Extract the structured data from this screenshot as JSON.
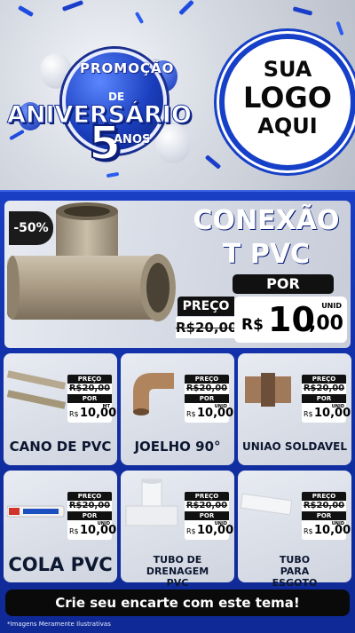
{
  "header": {
    "badge": {
      "promo": "PROMOÇÃO",
      "de": "DE",
      "aniversario": "ANIVERSÁRIO",
      "number": "5",
      "anos": "ANOS"
    },
    "logo_placeholder": [
      "SUA",
      "LOGO",
      "AQUI"
    ]
  },
  "hero": {
    "discount_badge": "-50%",
    "title_line1": "CONEXÃO",
    "title_line2": "T PVC",
    "por_label": "POR",
    "preco_label": "PREÇO",
    "old_price": "R$20,00",
    "new_price_currency": "R$",
    "new_price_integer": "10",
    "new_price_decimal": ",00",
    "unit": "UNID"
  },
  "products": [
    {
      "name": "CANO DE PVC",
      "preco_label": "PREÇO",
      "old_price": "R$20,00",
      "por_label": "POR",
      "currency": "R$",
      "price": "10,00",
      "unit": "MT"
    },
    {
      "name": "JOELHO 90°",
      "preco_label": "PREÇO",
      "old_price": "R$20,00",
      "por_label": "POR",
      "currency": "R$",
      "price": "10,00",
      "unit": "UNID"
    },
    {
      "name": "UNIAO SOLDAVEL",
      "preco_label": "PREÇO",
      "old_price": "R$20,00",
      "por_label": "POR",
      "currency": "R$",
      "price": "10,00",
      "unit": "UNID"
    },
    {
      "name": "COLA PVC",
      "preco_label": "PREÇO",
      "old_price": "R$20,00",
      "por_label": "POR",
      "currency": "R$",
      "price": "10,00",
      "unit": "UNID"
    },
    {
      "name": "TUBO DE DRENAGEM PVC",
      "preco_label": "PREÇO",
      "old_price": "R$20,00",
      "por_label": "POR",
      "currency": "R$",
      "price": "10,00",
      "unit": "UNID"
    },
    {
      "name": "TUBO PARA ESGOTO",
      "preco_label": "PREÇO",
      "old_price": "R$20,00",
      "por_label": "POR",
      "currency": "R$",
      "price": "10,00",
      "unit": "UNID"
    }
  ],
  "cta": "Crie seu encarte com este tema!",
  "disclaimer": "*Imagens Meramente Ilustrativas",
  "colors": {
    "brand_blue": "#1640c8",
    "dark": "#111111",
    "pvc_brown": "#a89a83"
  }
}
